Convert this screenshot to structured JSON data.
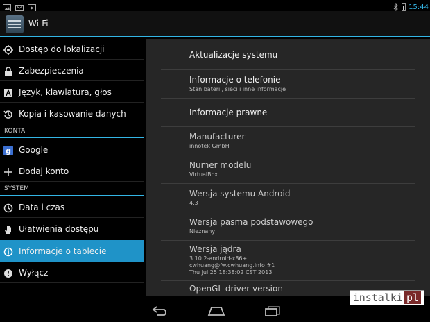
{
  "status": {
    "time": "15:44"
  },
  "header": {
    "title": "Wi-Fi"
  },
  "sidebar": {
    "items": [
      {
        "label": "Dostęp do lokalizacji",
        "icon": "location-icon"
      },
      {
        "label": "Zabezpieczenia",
        "icon": "lock-icon"
      },
      {
        "label": "Język, klawiatura, głos",
        "icon": "keyboard-icon"
      },
      {
        "label": "Kopia i kasowanie danych",
        "icon": "backup-icon"
      }
    ],
    "section_accounts": "KONTA",
    "accounts": [
      {
        "label": "Google",
        "icon": "google-icon"
      },
      {
        "label": "Dodaj konto",
        "icon": "plus-icon"
      }
    ],
    "section_system": "SYSTEM",
    "system": [
      {
        "label": "Data i czas",
        "icon": "clock-icon"
      },
      {
        "label": "Ułatwienia dostępu",
        "icon": "hand-icon"
      },
      {
        "label": "Informacje o tablecie",
        "icon": "info-icon"
      },
      {
        "label": "Wyłącz",
        "icon": "power-icon"
      }
    ]
  },
  "main": {
    "rows": [
      {
        "title": "Aktualizacje systemu",
        "sub": ""
      },
      {
        "title": "Informacje o telefonie",
        "sub": "Stan baterii, sieci i inne informacje"
      },
      {
        "title": "Informacje prawne",
        "sub": ""
      },
      {
        "title": "Manufacturer",
        "sub": "innotek GmbH"
      },
      {
        "title": "Numer modelu",
        "sub": "VirtualBox"
      },
      {
        "title": "Wersja systemu Android",
        "sub": "4.3"
      },
      {
        "title": "Wersja pasma podstawowego",
        "sub": "Nieznany"
      },
      {
        "title": "Wersja jądra",
        "sub1": "3.10.2-android-x86+",
        "sub2": "cwhuang@fw.cwhuang.info #1",
        "sub3": "Thu Jul 25 18:38:02 CST 2013"
      },
      {
        "title": "OpenGL driver version",
        "sub": ""
      }
    ]
  },
  "watermark": {
    "text": "instalki",
    "mark": "pl"
  },
  "colors": {
    "accent": "#33b5e5",
    "selected": "#1f93c8"
  }
}
